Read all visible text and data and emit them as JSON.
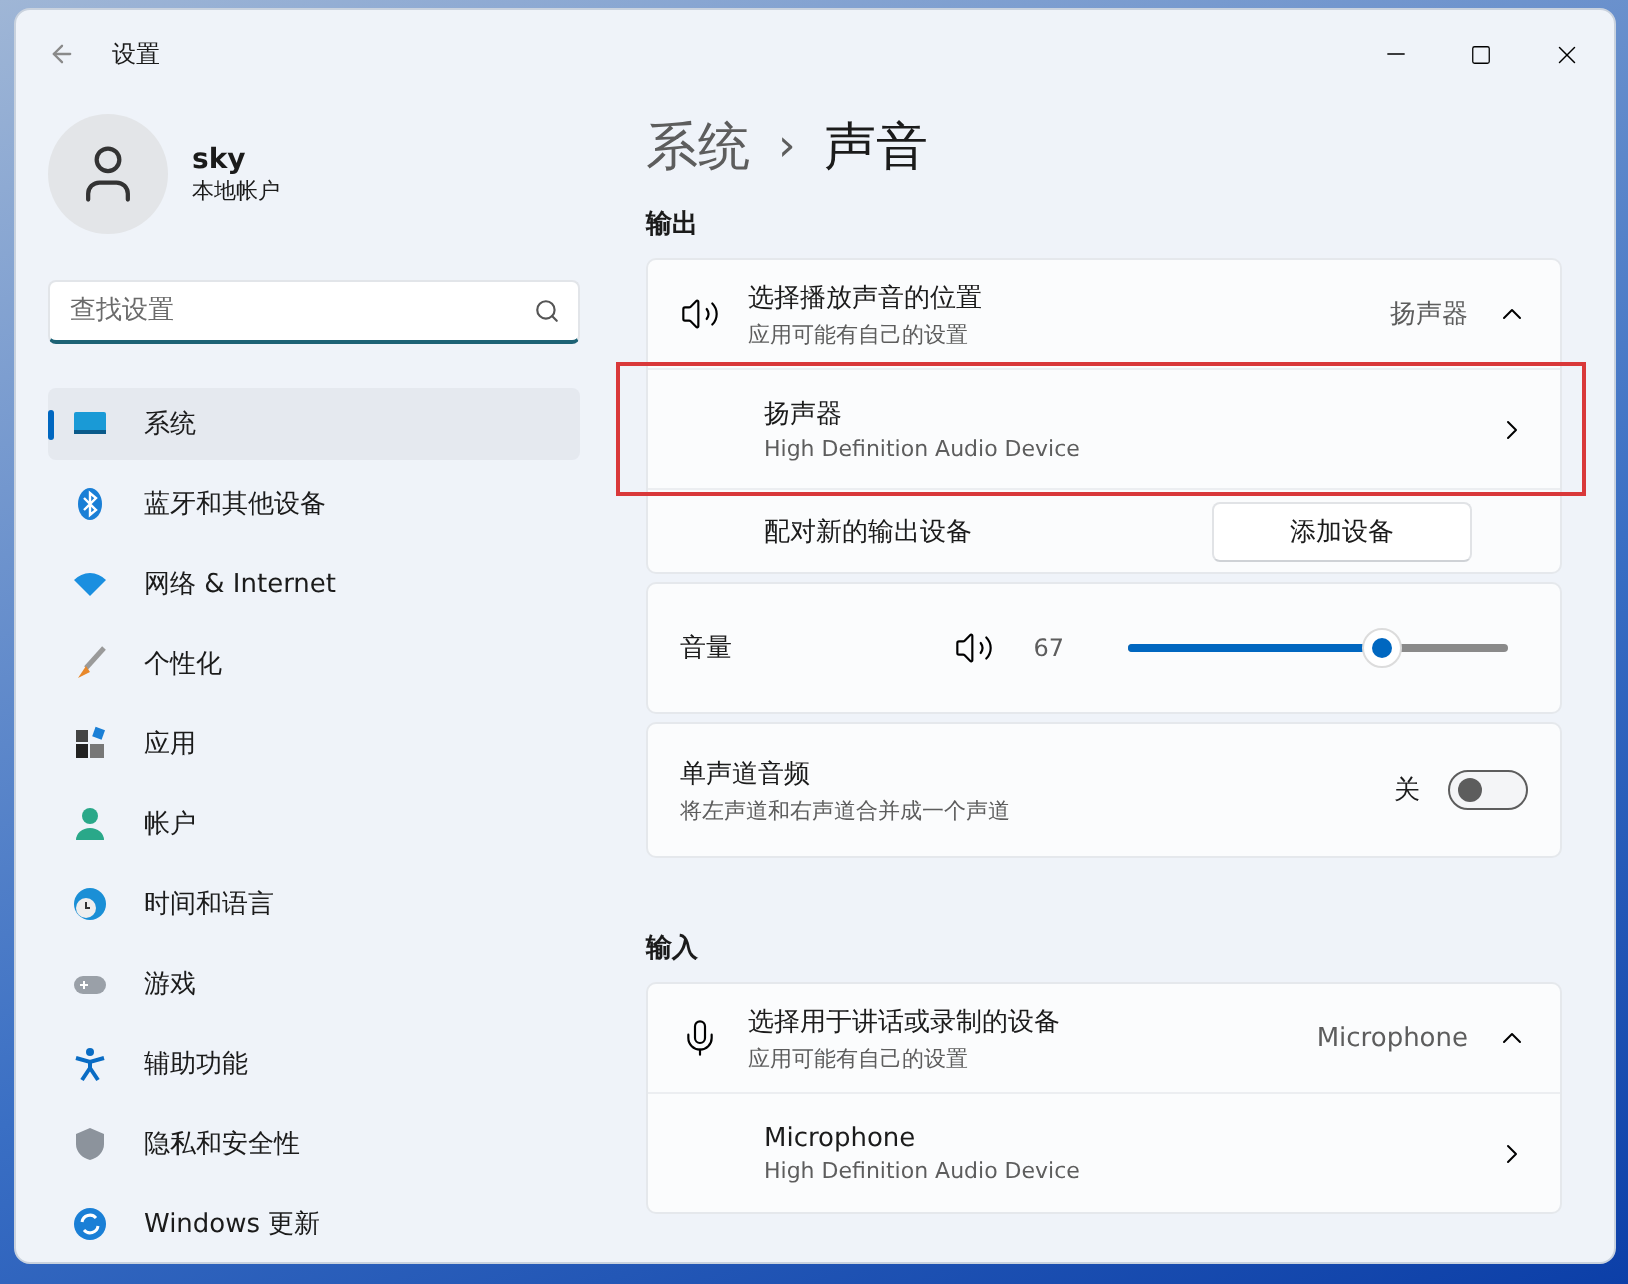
{
  "window": {
    "title": "设置"
  },
  "account": {
    "name": "sky",
    "type": "本地帐户"
  },
  "search": {
    "placeholder": "查找设置"
  },
  "nav": [
    {
      "label": "系统",
      "kind": "display",
      "selected": true
    },
    {
      "label": "蓝牙和其他设备",
      "kind": "bluetooth",
      "selected": false
    },
    {
      "label": "网络 & Internet",
      "kind": "wifi",
      "selected": false
    },
    {
      "label": "个性化",
      "kind": "brush",
      "selected": false
    },
    {
      "label": "应用",
      "kind": "apps",
      "selected": false
    },
    {
      "label": "帐户",
      "kind": "person",
      "selected": false
    },
    {
      "label": "时间和语言",
      "kind": "clock",
      "selected": false
    },
    {
      "label": "游戏",
      "kind": "gamepad",
      "selected": false
    },
    {
      "label": "辅助功能",
      "kind": "accessibility",
      "selected": false
    },
    {
      "label": "隐私和安全性",
      "kind": "shield",
      "selected": false
    },
    {
      "label": "Windows 更新",
      "kind": "update",
      "selected": false
    }
  ],
  "breadcrumb": {
    "parent": "系统",
    "separator": "›",
    "current": "声音"
  },
  "output": {
    "heading": "输出",
    "chooser": {
      "title": "选择播放声音的位置",
      "subtitle": "应用可能有自己的设置",
      "value": "扬声器",
      "expanded": true
    },
    "devices": [
      {
        "name": "扬声器",
        "detail": "High Definition Audio Device",
        "highlighted": true
      }
    ],
    "pair": {
      "label": "配对新的输出设备",
      "button": "添加设备"
    }
  },
  "volume": {
    "label": "音量",
    "reading": "67",
    "level": 0.67
  },
  "mono": {
    "title": "单声道音频",
    "subtitle": "将左声道和右声道合并成一个声道",
    "state_label": "关",
    "on": false
  },
  "input": {
    "heading": "输入",
    "chooser": {
      "title": "选择用于讲话或录制的设备",
      "subtitle": "应用可能有自己的设置",
      "value": "Microphone",
      "expanded": true
    },
    "devices": [
      {
        "name": "Microphone",
        "detail": "High Definition Audio Device",
        "highlighted": false
      }
    ]
  }
}
